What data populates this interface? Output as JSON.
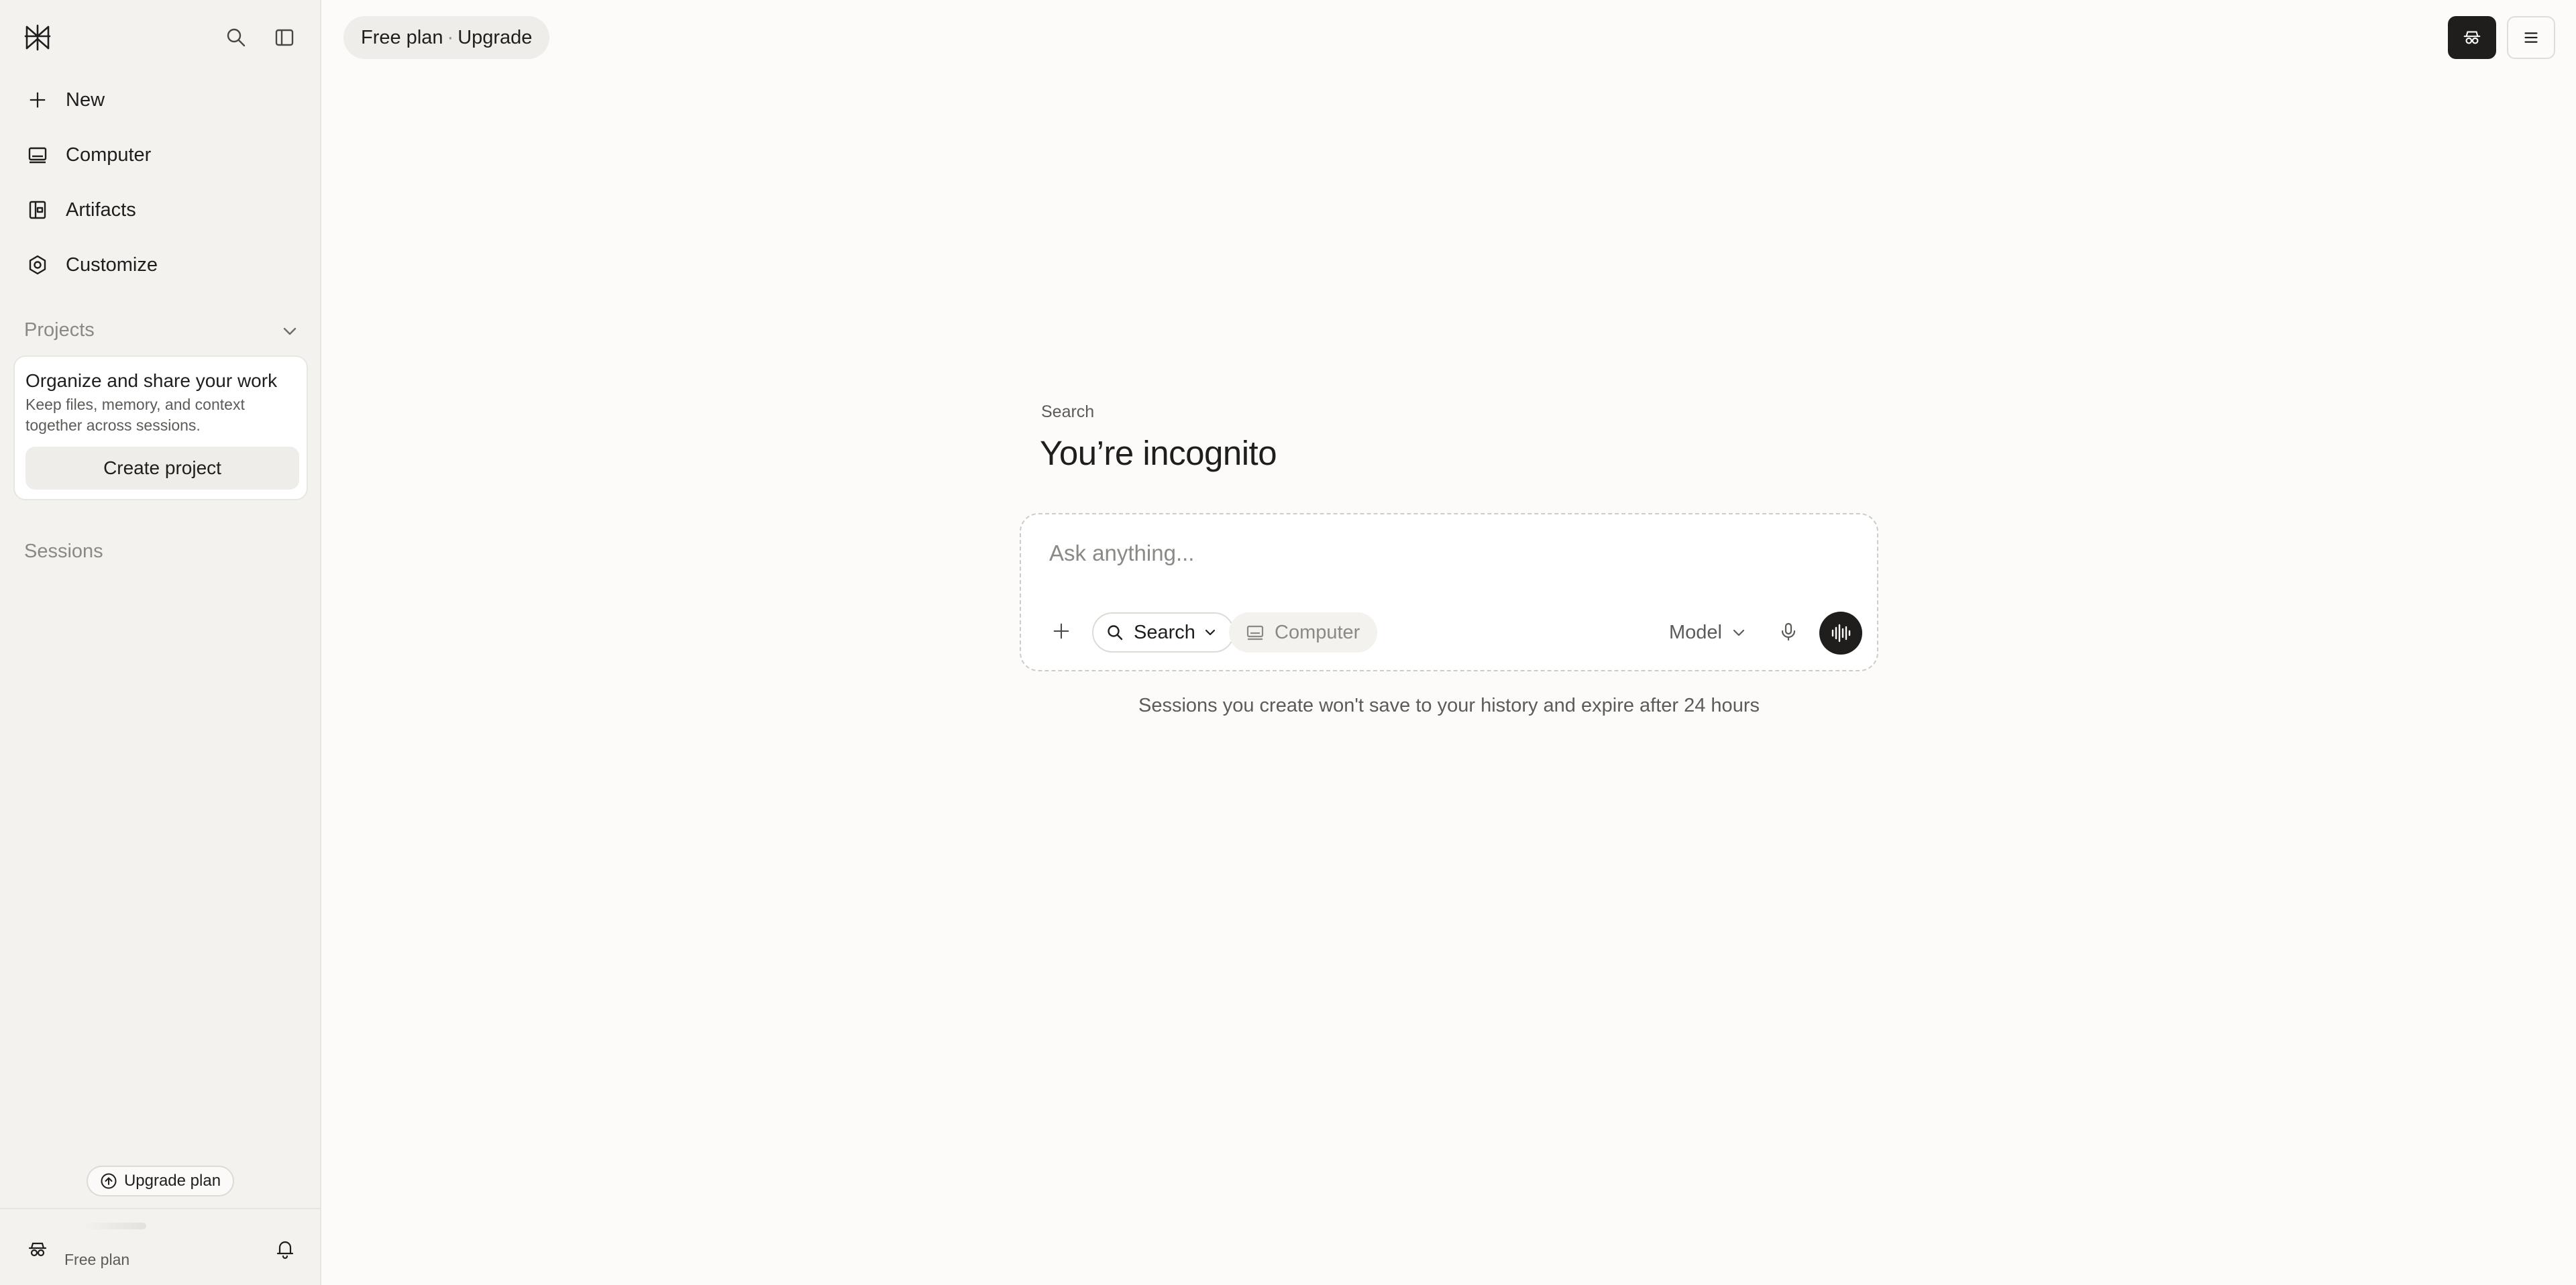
{
  "sidebar": {
    "nav": [
      {
        "label": "New",
        "icon": "plus-icon"
      },
      {
        "label": "Computer",
        "icon": "computer-icon"
      },
      {
        "label": "Artifacts",
        "icon": "artifacts-icon"
      },
      {
        "label": "Customize",
        "icon": "customize-icon"
      }
    ],
    "projects_label": "Projects",
    "project_card": {
      "title": "Organize and share your work",
      "description": "Keep files, memory, and context together across sessions.",
      "button": "Create project"
    },
    "sessions_label": "Sessions",
    "upgrade_plan": "Upgrade plan",
    "plan_text": "Free plan"
  },
  "header": {
    "plan": "Free plan",
    "separator": "·",
    "upgrade": "Upgrade"
  },
  "main": {
    "mode_label": "Search",
    "headline": "You’re incognito",
    "composer": {
      "placeholder": "Ask anything...",
      "search_mode": "Search",
      "computer_mode": "Computer",
      "model": "Model"
    },
    "notice": "Sessions you create won't save to your history and expire after 24 hours"
  },
  "colors": {
    "background": "#fcfbf9",
    "sidebar": "#f3f2ef",
    "accent_dark": "#1f1e1c",
    "muted_text": "#8b8984"
  }
}
